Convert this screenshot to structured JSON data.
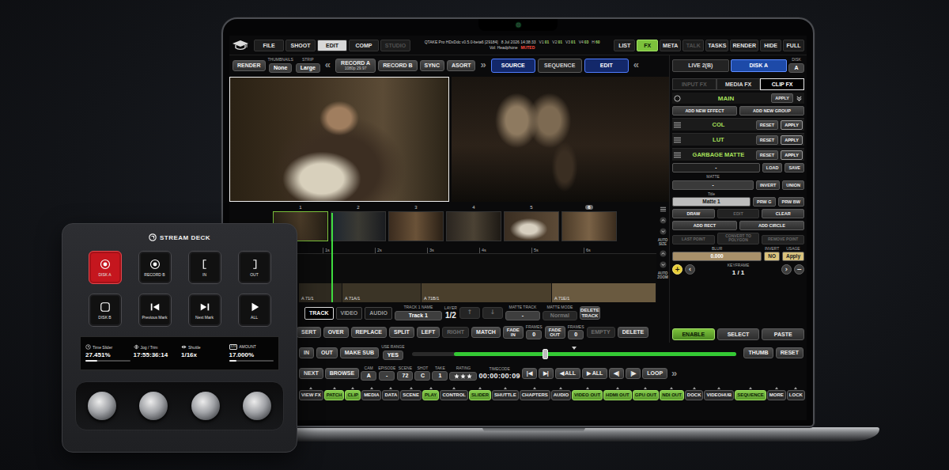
{
  "screen": {
    "topbar": {
      "left_tabs": [
        {
          "label": "FILE",
          "selected": false,
          "disabled": false
        },
        {
          "label": "SHOOT",
          "selected": false,
          "disabled": false
        },
        {
          "label": "EDIT",
          "selected": true,
          "disabled": false
        },
        {
          "label": "COMP",
          "selected": false,
          "disabled": false
        },
        {
          "label": "STUDIO",
          "selected": false,
          "disabled": true
        }
      ],
      "product": "QTAKE Pro HDxDdc v0.5.0-beta6 [29184]",
      "datetime": "8 Jul 2026 14:38:33",
      "counters": [
        {
          "label": "V1",
          "value": "01"
        },
        {
          "label": "V2",
          "value": "01"
        },
        {
          "label": "V3",
          "value": "01"
        },
        {
          "label": "V4",
          "value": "03"
        },
        {
          "label": "H",
          "value": "60"
        }
      ],
      "volume": "Vol: Headphone",
      "volume_state": "MUTED",
      "right_tabs": [
        {
          "label": "LIST",
          "selected": false,
          "disabled": false
        },
        {
          "label": "FX",
          "selected": true,
          "disabled": false
        },
        {
          "label": "META",
          "selected": false,
          "disabled": false
        },
        {
          "label": "TALK",
          "selected": false,
          "disabled": true
        },
        {
          "label": "TASKS",
          "selected": false,
          "disabled": false
        },
        {
          "label": "RENDER",
          "selected": false,
          "disabled": false
        },
        {
          "label": "HIDE",
          "selected": false,
          "disabled": false
        },
        {
          "label": "FULL",
          "selected": false,
          "disabled": false
        }
      ]
    },
    "toolbar": [
      {
        "kind": "button",
        "label": "RENDER"
      },
      {
        "kind": "field",
        "caption": "THUMBNAILS",
        "value": "None"
      },
      {
        "kind": "field",
        "caption": "STRIP",
        "value": "Large"
      },
      {
        "kind": "nav",
        "label": "«"
      },
      {
        "kind": "record",
        "label": "RECORD A",
        "sub": "1080p 29.97"
      },
      {
        "kind": "button",
        "label": "RECORD B"
      },
      {
        "kind": "button",
        "label": "SYNC"
      },
      {
        "kind": "button",
        "label": "ASORT"
      },
      {
        "kind": "nav",
        "label": "»"
      },
      {
        "kind": "mode",
        "label": "SOURCE",
        "selected": true
      },
      {
        "kind": "mode",
        "label": "SEQUENCE",
        "selected": false
      },
      {
        "kind": "mode",
        "label": "EDIT",
        "selected": true
      },
      {
        "kind": "nav",
        "label": "«"
      }
    ],
    "disk_tabs": [
      {
        "label": "LIVE 2(B)",
        "selected": false
      },
      {
        "label": "DISK A",
        "selected": true
      }
    ],
    "disk_select": {
      "kind": "field",
      "caption": "DISK",
      "value": "A"
    },
    "fx": {
      "tabs": [
        {
          "label": "INPUT FX",
          "selected": false,
          "disabled": true
        },
        {
          "label": "MEDIA FX",
          "selected": false,
          "disabled": false
        },
        {
          "label": "CLIP FX",
          "selected": true,
          "disabled": false
        }
      ],
      "group": {
        "label": "MAIN",
        "action": "APPLY"
      },
      "add": [
        "ADD NEW EFFECT",
        "ADD NEW GROUP"
      ],
      "effects": [
        {
          "name": "COL",
          "reset": "RESET",
          "apply": "APPLY"
        },
        {
          "name": "LUT",
          "reset": "RESET",
          "apply": "APPLY"
        },
        {
          "name": "GARBAGE MATTE",
          "reset": "RESET",
          "apply": "APPLY"
        }
      ],
      "preset": {
        "value": "-",
        "load": "LOAD",
        "save": "SAVE"
      },
      "matte": {
        "caption": "MATTE",
        "value": "-",
        "actions": [
          "INVERT",
          "UNION"
        ]
      },
      "title": {
        "caption": "Title",
        "value": "Matte 1",
        "actions": [
          "PRW G",
          "PRW BW"
        ]
      },
      "draw": [
        {
          "label": "DRAW",
          "disabled": false
        },
        {
          "label": "EDIT",
          "disabled": true
        },
        {
          "label": "CLEAR",
          "disabled": false
        }
      ],
      "shapes": [
        "ADD RECT",
        "ADD CIRCLE"
      ],
      "points": [
        {
          "label": "LAST POINT",
          "disabled": true
        },
        {
          "label": "CONVERT TO POLYGON",
          "disabled": true
        },
        {
          "label": "REMOVE POINT",
          "disabled": true
        }
      ],
      "blur": {
        "caption": "BLUR",
        "value": "0.000"
      },
      "invert": {
        "caption": "INVERT",
        "value": "NO"
      },
      "usage": {
        "caption": "USAGE",
        "value": "Apply"
      },
      "keyframe": {
        "caption": "KEYFRAME",
        "value": "1 / 1",
        "add": "+",
        "prev": "‹",
        "next": "›",
        "remove": "−"
      }
    },
    "enable": [
      {
        "label": "ENABLE",
        "selected": true
      },
      {
        "label": "SELECT",
        "selected": false
      },
      {
        "label": "PASTE",
        "selected": false
      }
    ],
    "timeline": {
      "clips": [
        {
          "number": "1",
          "selected": true,
          "current": false
        },
        {
          "number": "2",
          "selected": false,
          "current": false
        },
        {
          "number": "3",
          "selected": false,
          "current": false
        },
        {
          "number": "4",
          "selected": false,
          "current": false
        },
        {
          "number": "5",
          "selected": false,
          "current": false
        },
        {
          "number": "6",
          "selected": false,
          "current": true
        }
      ],
      "ruler": [
        "1s",
        "2s",
        "3s",
        "4s",
        "5s",
        "6s"
      ],
      "segments": [
        {
          "label": "A 71/1"
        },
        {
          "label": "A 71A/1"
        },
        {
          "label": "A 71B/1"
        },
        {
          "label": "A 71E/1"
        }
      ],
      "side": [
        "AUTO SIZE",
        "AUTO ZOOM"
      ]
    },
    "track_bar": [
      {
        "kind": "tab",
        "label": "TRACK",
        "selected": true
      },
      {
        "kind": "tab",
        "label": "VIDEO",
        "selected": false
      },
      {
        "kind": "tab",
        "label": "AUDIO",
        "selected": false
      },
      {
        "kind": "field",
        "caption": "TRACK 1 NAME",
        "value": "Track 1",
        "disabled": false
      },
      {
        "kind": "readout",
        "caption": "LAYER",
        "value": "1/2"
      },
      {
        "kind": "arrow",
        "label": "↑",
        "disabled": true
      },
      {
        "kind": "arrow",
        "label": "↓",
        "disabled": true
      },
      {
        "kind": "field",
        "caption": "MATTE TRACK",
        "value": "-",
        "disabled": false
      },
      {
        "kind": "field",
        "caption": "MATTE MODE",
        "value": "Normal",
        "disabled": true
      },
      {
        "kind": "wrap",
        "label": "DELETE TRACK",
        "disabled": false
      }
    ],
    "edit_bar": [
      {
        "kind": "button",
        "label": "SERT",
        "disabled": false
      },
      {
        "kind": "button",
        "label": "OVER",
        "disabled": false
      },
      {
        "kind": "button",
        "label": "REPLACE",
        "disabled": false
      },
      {
        "kind": "button",
        "label": "SPLIT",
        "disabled": false
      },
      {
        "kind": "button",
        "label": "LEFT",
        "disabled": false
      },
      {
        "kind": "button",
        "label": "RIGHT",
        "disabled": true
      },
      {
        "kind": "button",
        "label": "MATCH",
        "disabled": false
      },
      {
        "kind": "wrap",
        "label": "FADE IN",
        "disabled": false
      },
      {
        "kind": "field",
        "caption": "FRAMES",
        "value": "0"
      },
      {
        "kind": "wrap",
        "label": "FADE OUT",
        "disabled": false
      },
      {
        "kind": "field",
        "caption": "FRAMES",
        "value": "0"
      },
      {
        "kind": "button",
        "label": "EMPTY",
        "disabled": true
      },
      {
        "kind": "button",
        "label": "DELETE",
        "disabled": false
      }
    ],
    "range_bar": {
      "left": [
        {
          "kind": "button",
          "label": "IN"
        },
        {
          "kind": "button",
          "label": "OUT"
        },
        {
          "kind": "button",
          "label": "MAKE SUB"
        },
        {
          "kind": "field",
          "caption": "USE RANGE",
          "value": "YES"
        }
      ],
      "slider": {
        "start": 0.13,
        "end": 1.0,
        "handle": 0.41,
        "marker": 0.5
      },
      "right": [
        {
          "kind": "button",
          "label": "THUMB"
        },
        {
          "kind": "button",
          "label": "RESET"
        }
      ]
    },
    "meta_bar": [
      {
        "kind": "button",
        "label": "NEXT"
      },
      {
        "kind": "button",
        "label": "BROWSE"
      },
      {
        "kind": "field",
        "caption": "CAM",
        "value": "A"
      },
      {
        "kind": "field",
        "caption": "EPISODE",
        "value": "-"
      },
      {
        "kind": "field",
        "caption": "SCENE",
        "value": "72"
      },
      {
        "kind": "field",
        "caption": "SHOT",
        "value": "C"
      },
      {
        "kind": "field",
        "caption": "TAKE",
        "value": "1"
      },
      {
        "kind": "stars",
        "caption": "RATING",
        "stars": 3
      },
      {
        "kind": "timecode",
        "caption": "TIMECODE",
        "value": "00:00:00:09"
      },
      {
        "kind": "button",
        "label": "|◀"
      },
      {
        "kind": "button",
        "label": "▶|"
      },
      {
        "kind": "button",
        "label": "◀ ALL"
      },
      {
        "kind": "button",
        "label": "▶ ALL"
      },
      {
        "kind": "button",
        "label": "◀|"
      },
      {
        "kind": "button",
        "label": "|▶"
      },
      {
        "kind": "button",
        "label": "LOOP"
      },
      {
        "kind": "nav",
        "label": "»"
      }
    ],
    "panel_bar": [
      {
        "kind": "panel",
        "label": "VIEW FX",
        "on": false
      },
      {
        "kind": "panel",
        "label": "PATCH",
        "on": true
      },
      {
        "kind": "panel",
        "label": "CLIP",
        "on": true
      },
      {
        "kind": "panel",
        "label": "MEDIA",
        "on": false
      },
      {
        "kind": "panel",
        "label": "DATA",
        "on": false
      },
      {
        "kind": "panel",
        "label": "SCENE",
        "on": false
      },
      {
        "kind": "panel",
        "label": "PLAY",
        "on": true
      },
      {
        "kind": "panel",
        "label": "CONTROL",
        "on": false
      },
      {
        "kind": "panel",
        "label": "SLIDER",
        "on": true
      },
      {
        "kind": "panel",
        "label": "SHUTTLE",
        "on": false
      },
      {
        "kind": "panel",
        "label": "CHAPTERS",
        "on": false
      },
      {
        "kind": "panel",
        "label": "AUDIO",
        "on": false
      },
      {
        "kind": "panel",
        "label": "VIDEO OUT",
        "on": true
      },
      {
        "kind": "panel",
        "label": "HDMI OUT",
        "on": true
      },
      {
        "kind": "panel",
        "label": "GPU OUT",
        "on": true
      },
      {
        "kind": "panel",
        "label": "NDI OUT",
        "on": true
      },
      {
        "kind": "panel",
        "label": "DOCK",
        "on": false
      },
      {
        "kind": "panel",
        "label": "VIDEOHUB",
        "on": false
      },
      {
        "kind": "panel",
        "label": "SEQUENCE",
        "on": true
      },
      {
        "kind": "panel",
        "label": "MORE",
        "on": false
      },
      {
        "kind": "panel",
        "label": "LOCK",
        "on": false
      }
    ]
  },
  "stream_deck": {
    "brand": "STREAM DECK",
    "keys": [
      {
        "label": "DISK A",
        "kind": "record",
        "active": true
      },
      {
        "label": "RECORD B",
        "kind": "record",
        "active": false
      },
      {
        "label": "IN",
        "kind": "in",
        "active": false
      },
      {
        "label": "OUT",
        "kind": "out",
        "active": false
      },
      {
        "label": "DISK B",
        "kind": "disk",
        "active": false
      },
      {
        "label": "Previous Mark",
        "kind": "previous",
        "active": false
      },
      {
        "label": "Next Mark",
        "kind": "next",
        "active": false
      },
      {
        "label": "ALL",
        "kind": "play",
        "active": false
      }
    ],
    "dials": [
      {
        "label": "Time Slider",
        "value": "27.451%",
        "kind": "time",
        "level": 0.27
      },
      {
        "label": "Jog / Trim",
        "value": "17:55:36:14",
        "kind": "jog"
      },
      {
        "label": "Shuttle",
        "value": "1/16x",
        "kind": "shuttle"
      },
      {
        "label": "AMOUNT",
        "value": "17.000%",
        "kind": "amount",
        "badge": "123",
        "level": 0.17
      }
    ]
  }
}
